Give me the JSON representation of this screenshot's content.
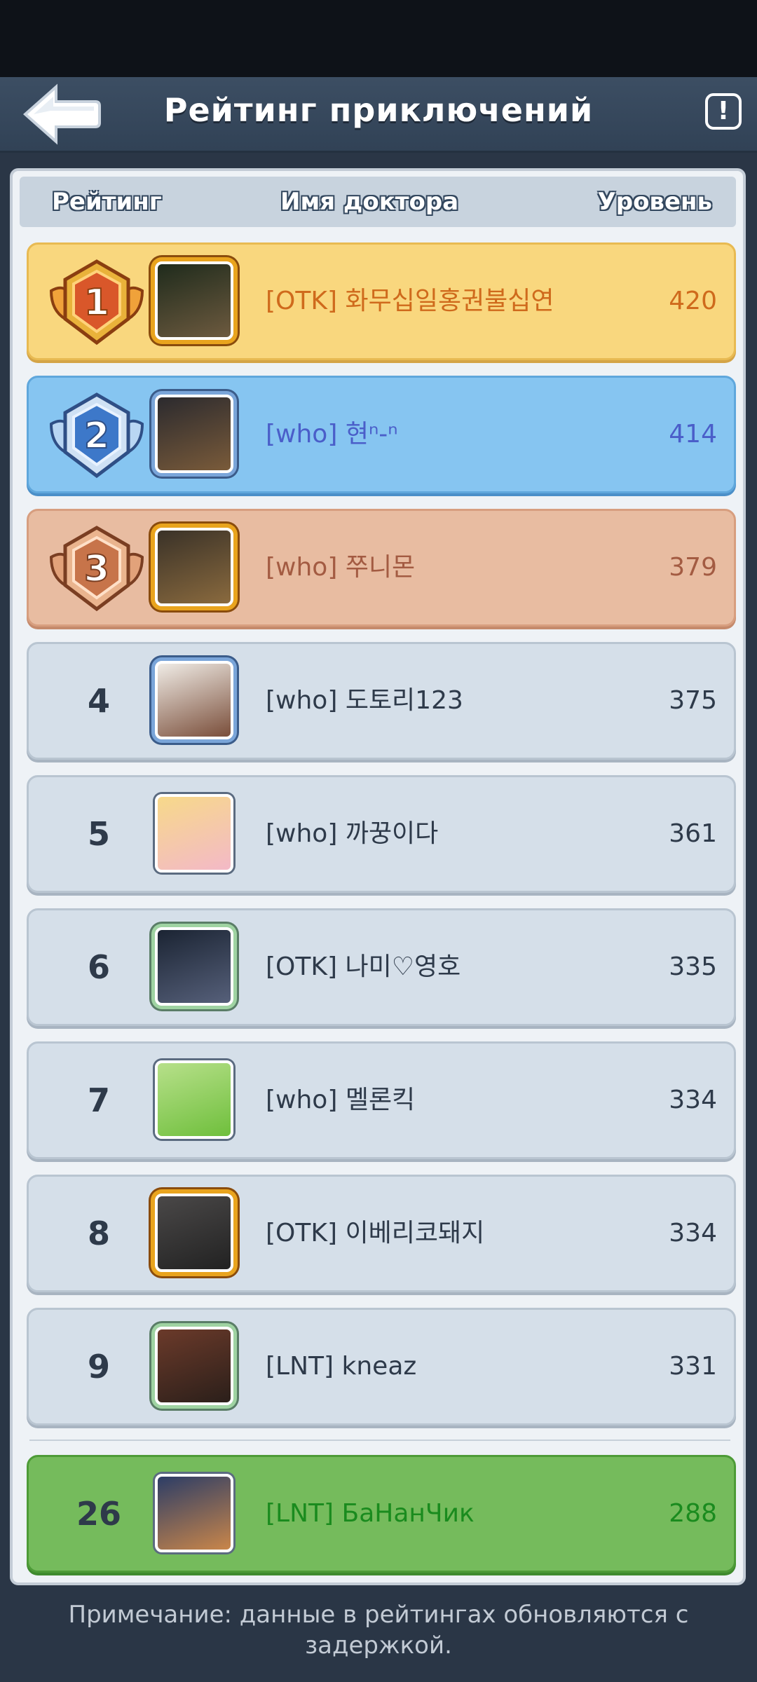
{
  "header": {
    "title": "Рейтинг приключений"
  },
  "columns": {
    "rating": "Рейтинг",
    "name": "Имя доктора",
    "level": "Уровень"
  },
  "rows": [
    {
      "rank": "1",
      "name": "[OTK] 화무십일홍권불십연",
      "level": "420",
      "style": "gold",
      "avatar_colors": [
        "#1f2b1c",
        "#6d5a3f"
      ]
    },
    {
      "rank": "2",
      "name": "[who] 현ⁿ-ⁿ",
      "level": "414",
      "style": "blue",
      "avatar_colors": [
        "#2b2a2e",
        "#7a5b3a"
      ]
    },
    {
      "rank": "3",
      "name": "[who] 쭈니몬",
      "level": "379",
      "style": "bronze",
      "avatar_colors": [
        "#3a3228",
        "#8a6a3e"
      ]
    },
    {
      "rank": "4",
      "name": "[who] 도토리123",
      "level": "375",
      "style": "normal",
      "avatar_colors": [
        "#f0ece6",
        "#7a4e3a"
      ]
    },
    {
      "rank": "5",
      "name": "[who] 까꿍이다",
      "level": "361",
      "style": "normal",
      "avatar_colors": [
        "#f7d98a",
        "#f3b9c7"
      ]
    },
    {
      "rank": "6",
      "name": "[OTK] 나미♡영호",
      "level": "335",
      "style": "normal",
      "avatar_colors": [
        "#1b2433",
        "#56607a"
      ]
    },
    {
      "rank": "7",
      "name": "[who] 멜론킥",
      "level": "334",
      "style": "normal",
      "avatar_colors": [
        "#b7e08a",
        "#6fbf3c"
      ]
    },
    {
      "rank": "8",
      "name": "[OTK] 이베리코돼지",
      "level": "334",
      "style": "normal",
      "avatar_colors": [
        "#4a4848",
        "#222222"
      ]
    },
    {
      "rank": "9",
      "name": "[LNT] kneaz",
      "level": "331",
      "style": "normal",
      "avatar_colors": [
        "#6b3a2a",
        "#2b1f1a"
      ]
    }
  ],
  "self_row": {
    "rank": "26",
    "name": "[LNT] БаНанЧик",
    "level": "288",
    "style": "self",
    "avatar_colors": [
      "#2c3d66",
      "#c9864a"
    ]
  },
  "note": "Примечание: данные в рейтингах обновляются с задержкой.",
  "icons": {
    "back": "back-arrow-icon",
    "info": "info-icon"
  },
  "colors": {
    "gold_row": "#f9d77e",
    "silver_row": "#86c5f1",
    "bronze_row": "#e8bca1",
    "self_row": "#75bb5c",
    "normal_row": "#d5dfe9"
  }
}
